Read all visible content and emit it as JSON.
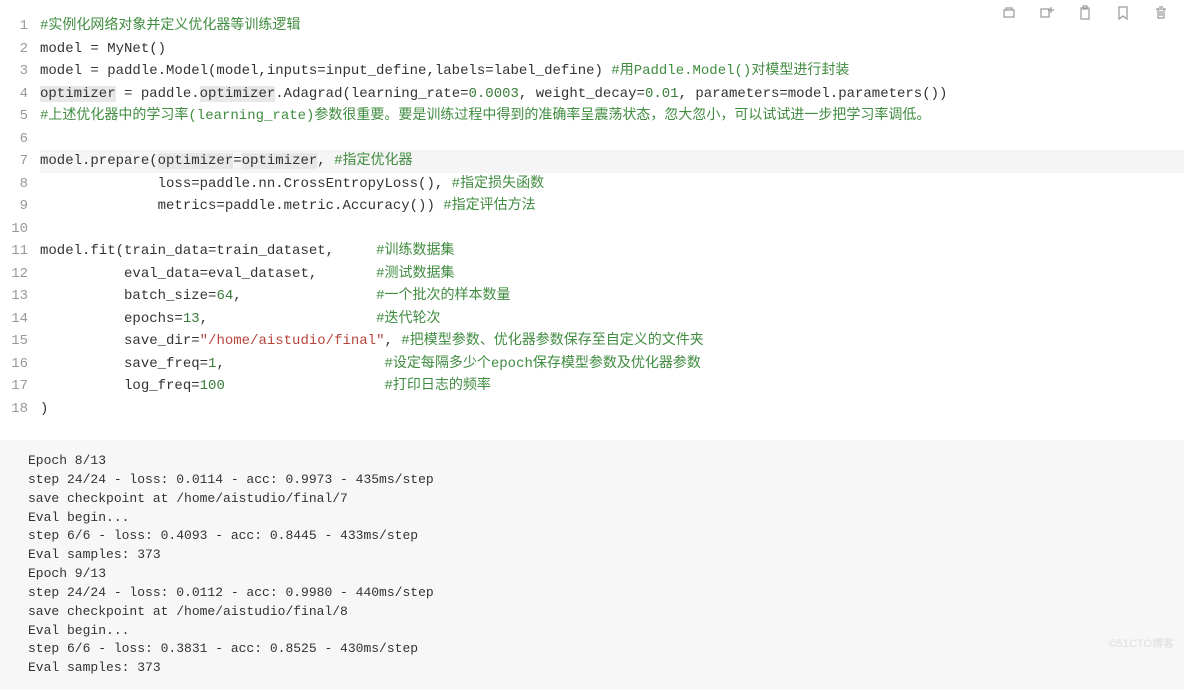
{
  "toolbar": {
    "icons": [
      "run-icon",
      "insert-icon",
      "clipboard-icon",
      "bookmark-icon",
      "delete-icon"
    ]
  },
  "code": {
    "lines": [
      {
        "n": "1",
        "segs": [
          {
            "t": "#实例化网络对象并定义优化器等训练逻辑",
            "cls": "comment"
          }
        ]
      },
      {
        "n": "2",
        "segs": [
          {
            "t": "model = MyNet()",
            "cls": ""
          }
        ]
      },
      {
        "n": "3",
        "segs": [
          {
            "t": "model = paddle.Model(model,inputs=input_define,labels=label_define) ",
            "cls": ""
          },
          {
            "t": "#用Paddle.Model()对模型进行封装",
            "cls": "comment"
          }
        ]
      },
      {
        "n": "4",
        "segs": [
          {
            "t": "optimizer",
            "cls": "hl-bg"
          },
          {
            "t": " = paddle.",
            "cls": ""
          },
          {
            "t": "optimizer",
            "cls": "hl-bg"
          },
          {
            "t": ".Adagrad(learning_rate=",
            "cls": ""
          },
          {
            "t": "0.0003",
            "cls": "number"
          },
          {
            "t": ", weight_decay=",
            "cls": ""
          },
          {
            "t": "0.01",
            "cls": "number"
          },
          {
            "t": ", parameters=model.parameters())",
            "cls": ""
          }
        ]
      },
      {
        "n": "5",
        "segs": [
          {
            "t": "#上述优化器中的学习率(learning_rate)参数很重要。要是训练过程中得到的准确率呈震荡状态，忽大忽小，可以试试进一步把学习率调低。",
            "cls": "comment"
          }
        ]
      },
      {
        "n": "6",
        "segs": [
          {
            "t": "",
            "cls": ""
          }
        ]
      },
      {
        "n": "7",
        "hl": true,
        "segs": [
          {
            "t": "model.prepare(",
            "cls": ""
          },
          {
            "t": "optimizer",
            "cls": "hl-bg"
          },
          {
            "t": "=",
            "cls": ""
          },
          {
            "t": "optimizer",
            "cls": "hl-bg"
          },
          {
            "t": ", ",
            "cls": ""
          },
          {
            "t": "#指定优化器",
            "cls": "comment"
          }
        ]
      },
      {
        "n": "8",
        "segs": [
          {
            "t": "              loss=paddle.nn.CrossEntropyLoss(), ",
            "cls": ""
          },
          {
            "t": "#指定损失函数",
            "cls": "comment"
          }
        ]
      },
      {
        "n": "9",
        "segs": [
          {
            "t": "              metrics=paddle.metric.Accuracy()) ",
            "cls": ""
          },
          {
            "t": "#指定评估方法",
            "cls": "comment"
          }
        ]
      },
      {
        "n": "10",
        "segs": [
          {
            "t": "",
            "cls": ""
          }
        ]
      },
      {
        "n": "11",
        "segs": [
          {
            "t": "model.fit(train_data=train_dataset,     ",
            "cls": ""
          },
          {
            "t": "#训练数据集",
            "cls": "comment"
          }
        ]
      },
      {
        "n": "12",
        "segs": [
          {
            "t": "          eval_data=eval_dataset,       ",
            "cls": ""
          },
          {
            "t": "#测试数据集",
            "cls": "comment"
          }
        ]
      },
      {
        "n": "13",
        "segs": [
          {
            "t": "          batch_size=",
            "cls": ""
          },
          {
            "t": "64",
            "cls": "number"
          },
          {
            "t": ",                ",
            "cls": ""
          },
          {
            "t": "#一个批次的样本数量",
            "cls": "comment"
          }
        ]
      },
      {
        "n": "14",
        "segs": [
          {
            "t": "          epochs=",
            "cls": ""
          },
          {
            "t": "13",
            "cls": "number"
          },
          {
            "t": ",                    ",
            "cls": ""
          },
          {
            "t": "#迭代轮次",
            "cls": "comment"
          }
        ]
      },
      {
        "n": "15",
        "segs": [
          {
            "t": "          save_dir=",
            "cls": ""
          },
          {
            "t": "\"/home/aistudio/final\"",
            "cls": "string"
          },
          {
            "t": ", ",
            "cls": ""
          },
          {
            "t": "#把模型参数、优化器参数保存至自定义的文件夹",
            "cls": "comment"
          }
        ]
      },
      {
        "n": "16",
        "segs": [
          {
            "t": "          save_freq=",
            "cls": ""
          },
          {
            "t": "1",
            "cls": "number"
          },
          {
            "t": ",                   ",
            "cls": ""
          },
          {
            "t": "#设定每隔多少个epoch保存模型参数及优化器参数",
            "cls": "comment"
          }
        ]
      },
      {
        "n": "17",
        "segs": [
          {
            "t": "          log_freq=",
            "cls": ""
          },
          {
            "t": "100",
            "cls": "number"
          },
          {
            "t": "                   ",
            "cls": ""
          },
          {
            "t": "#打印日志的频率",
            "cls": "comment"
          }
        ]
      },
      {
        "n": "18",
        "segs": [
          {
            "t": ")",
            "cls": ""
          }
        ]
      }
    ]
  },
  "output": {
    "lines": [
      "Epoch 8/13",
      "step 24/24 - loss: 0.0114 - acc: 0.9973 - 435ms/step",
      "save checkpoint at /home/aistudio/final/7",
      "Eval begin...",
      "step 6/6 - loss: 0.4093 - acc: 0.8445 - 433ms/step",
      "Eval samples: 373",
      "Epoch 9/13",
      "step 24/24 - loss: 0.0112 - acc: 0.9980 - 440ms/step",
      "save checkpoint at /home/aistudio/final/8",
      "Eval begin...",
      "step 6/6 - loss: 0.3831 - acc: 0.8525 - 430ms/step",
      "Eval samples: 373"
    ]
  },
  "watermark": "©51CTO博客"
}
